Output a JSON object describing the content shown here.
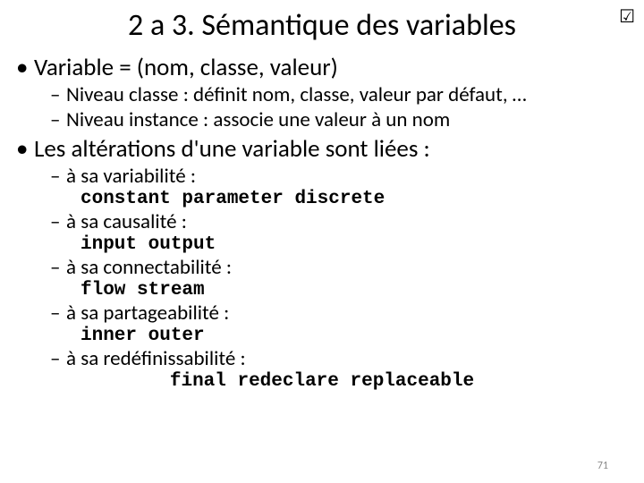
{
  "title": "2 a 3. Sémantique des variables",
  "checkmark": "☑",
  "b1": "Variable = (nom, classe, valeur)",
  "b1_1": "Niveau classe : définit nom, classe, valeur par défaut, …",
  "b1_2": "Niveau instance : associe une valeur à un nom",
  "b2": "Les altérations d'une variable sont liées :",
  "b2_1": "à sa variabilité :",
  "b2_1c": "constant parameter discrete",
  "b2_2": "à sa causalité :",
  "b2_2c": "input output",
  "b2_3": "à sa connectabilité :",
  "b2_3c": "flow stream",
  "b2_4": "à sa partageabilité :",
  "b2_4c": "inner outer",
  "b2_5": "à sa redéfinissabilité :",
  "b2_5c": "final redeclare replaceable",
  "page": "71"
}
